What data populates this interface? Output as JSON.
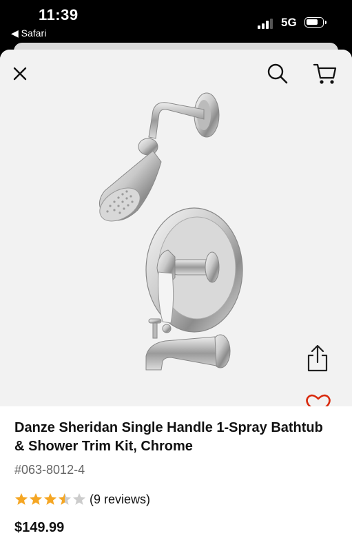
{
  "status_bar": {
    "time": "11:39",
    "back_app": "◀ Safari",
    "network": "5G",
    "signal_bars": 3,
    "signal_bars_total": 4,
    "battery_percent": 75
  },
  "header": {
    "close_icon": "close-icon",
    "search_icon": "search-icon",
    "cart_icon": "cart-icon"
  },
  "product": {
    "title": "Danze Sheridan Single Handle 1-Spray Bathtub & Shower Trim Kit, Chrome",
    "sku": "#063-8012-4",
    "rating": 3.5,
    "rating_max": 5,
    "reviews": "(9 reviews)",
    "price": "$149.99"
  },
  "actions": {
    "share_icon": "share-icon",
    "heart_icon": "heart-icon"
  },
  "colors": {
    "accent": "#d9290c",
    "star": "#f5a623",
    "star_empty": "#cccccc",
    "text": "#111111",
    "muted": "#666666"
  }
}
